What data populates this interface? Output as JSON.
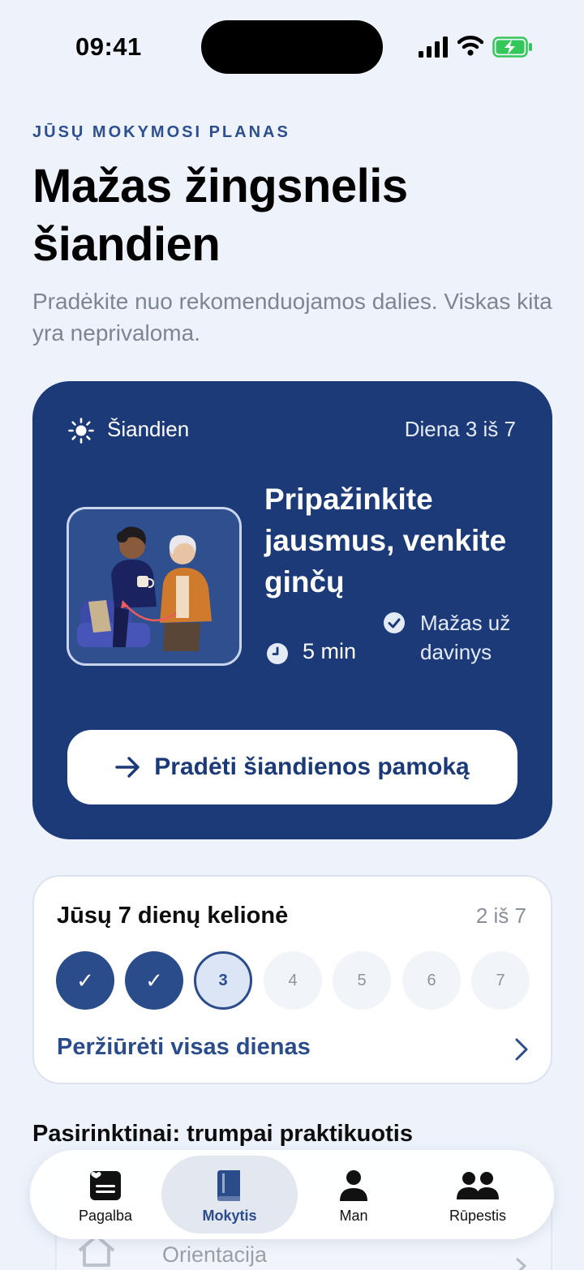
{
  "status_bar": {
    "time": "09:41"
  },
  "header": {
    "eyebrow": "JŪSŲ MOKYMOSI PLANAS",
    "title": "Mažas žingsnelis šiandien",
    "subtitle": "Pradėkite nuo rekomenduojamos dalies. Viskas kita yra neprivaloma."
  },
  "today": {
    "label": "Šiandien",
    "day": "Diena 3 iš 7",
    "lesson_title": "Pripažinkite jausmus, venkite ginčų",
    "duration": "5 min",
    "task": "Mažas uždavinys",
    "start_label": "Pradėti šiandienos pamoką"
  },
  "journey": {
    "title": "Jūsų 7 dienų kelionė",
    "count": "2 iš 7",
    "days": [
      {
        "label": "✓",
        "state": "done"
      },
      {
        "label": "✓",
        "state": "done"
      },
      {
        "label": "3",
        "state": "current"
      },
      {
        "label": "4",
        "state": "future"
      },
      {
        "label": "5",
        "state": "future"
      },
      {
        "label": "6",
        "state": "future"
      },
      {
        "label": "7",
        "state": "future"
      }
    ],
    "view_all": "Peržiūrėti visas dienas"
  },
  "optional": {
    "heading": "Pasirinktinai: trumpai praktikuotis",
    "item_label": "Orientacija"
  },
  "tabs": [
    {
      "label": "Pagalba",
      "icon": "help-card-icon",
      "active": false
    },
    {
      "label": "Mokytis",
      "icon": "book-icon",
      "active": true
    },
    {
      "label": "Man",
      "icon": "person-icon",
      "active": false
    },
    {
      "label": "Rūpestis",
      "icon": "people-icon",
      "active": false
    }
  ],
  "colors": {
    "accent": "#1c3a77",
    "link": "#2b4c8b",
    "background": "#eef3fb",
    "battery": "#34c759"
  }
}
